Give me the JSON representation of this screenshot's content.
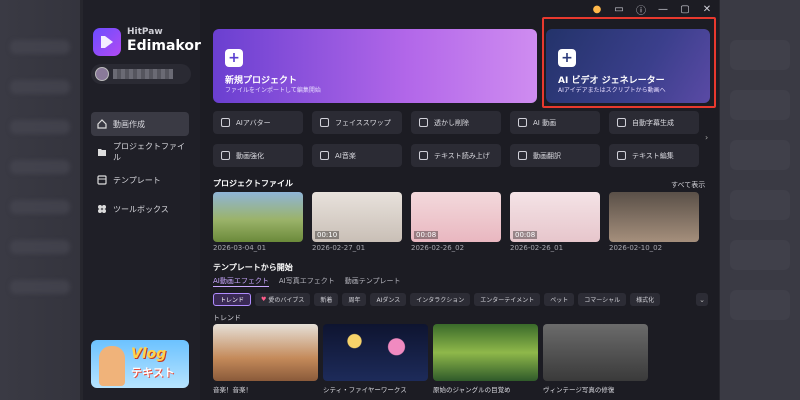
{
  "app": {
    "brand_small": "HitPaw",
    "brand_large": "Edimakor"
  },
  "sidebar": {
    "items": [
      {
        "label": "動画作成",
        "icon": "home-icon",
        "active": true
      },
      {
        "label": "プロジェクトファイル",
        "icon": "folder-icon",
        "active": false
      },
      {
        "label": "テンプレート",
        "icon": "template-icon",
        "active": false
      },
      {
        "label": "ツールボックス",
        "icon": "toolbox-icon",
        "active": false
      }
    ],
    "promo": {
      "line1": "Vlog",
      "line2": "テキスト"
    }
  },
  "hero": {
    "new_project": {
      "title": "新規プロジェクト",
      "subtitle": "ファイルをインポートして編集開始"
    },
    "ai_generator": {
      "title": "AI ビデオ ジェネレーター",
      "subtitle": "AIアイデアまたはスクリプトから動画へ"
    }
  },
  "tools": [
    {
      "label": "AIアバター",
      "icon": "avatar-icon"
    },
    {
      "label": "フェイススワップ",
      "icon": "face-swap-icon"
    },
    {
      "label": "透かし削除",
      "icon": "watermark-remove-icon"
    },
    {
      "label": "AI 動画",
      "icon": "ai-video-icon"
    },
    {
      "label": "自動字幕生成",
      "icon": "subtitle-icon"
    },
    {
      "label": "動画強化",
      "icon": "enhance-icon"
    },
    {
      "label": "AI音楽",
      "icon": "music-icon"
    },
    {
      "label": "テキスト読み上げ",
      "icon": "tts-icon"
    },
    {
      "label": "動画翻訳",
      "icon": "translate-icon"
    },
    {
      "label": "テキスト編集",
      "icon": "text-edit-icon"
    }
  ],
  "projects": {
    "heading": "プロジェクトファイル",
    "show_all": "すべて表示",
    "items": [
      {
        "date": "2026-03-04_01",
        "duration": ""
      },
      {
        "date": "2026-02-27_01",
        "duration": "00:10"
      },
      {
        "date": "2026-02-26_02",
        "duration": "00:08"
      },
      {
        "date": "2026-02-26_01",
        "duration": "00:08"
      },
      {
        "date": "2026-02-10_02",
        "duration": ""
      }
    ]
  },
  "templates": {
    "heading": "テンプレートから開始",
    "tabs": [
      "AI動画エフェクト",
      "AI写真エフェクト",
      "動画テンプレート"
    ],
    "chips": [
      "トレンド",
      "愛のバイブス",
      "新着",
      "周年",
      "AIダンス",
      "インタラクション",
      "エンターテイメント",
      "ペット",
      "コマーシャル",
      "様式化"
    ],
    "section_label": "トレンド",
    "items": [
      {
        "caption": "音楽！音楽！"
      },
      {
        "caption": "シティ・ファイヤーワークス"
      },
      {
        "caption": "原始のジャングルの目覚め"
      },
      {
        "caption": "ヴィンテージ写真の修復"
      }
    ]
  },
  "colors": {
    "accent": "#b08cff",
    "highlight_box": "#e8392e"
  }
}
